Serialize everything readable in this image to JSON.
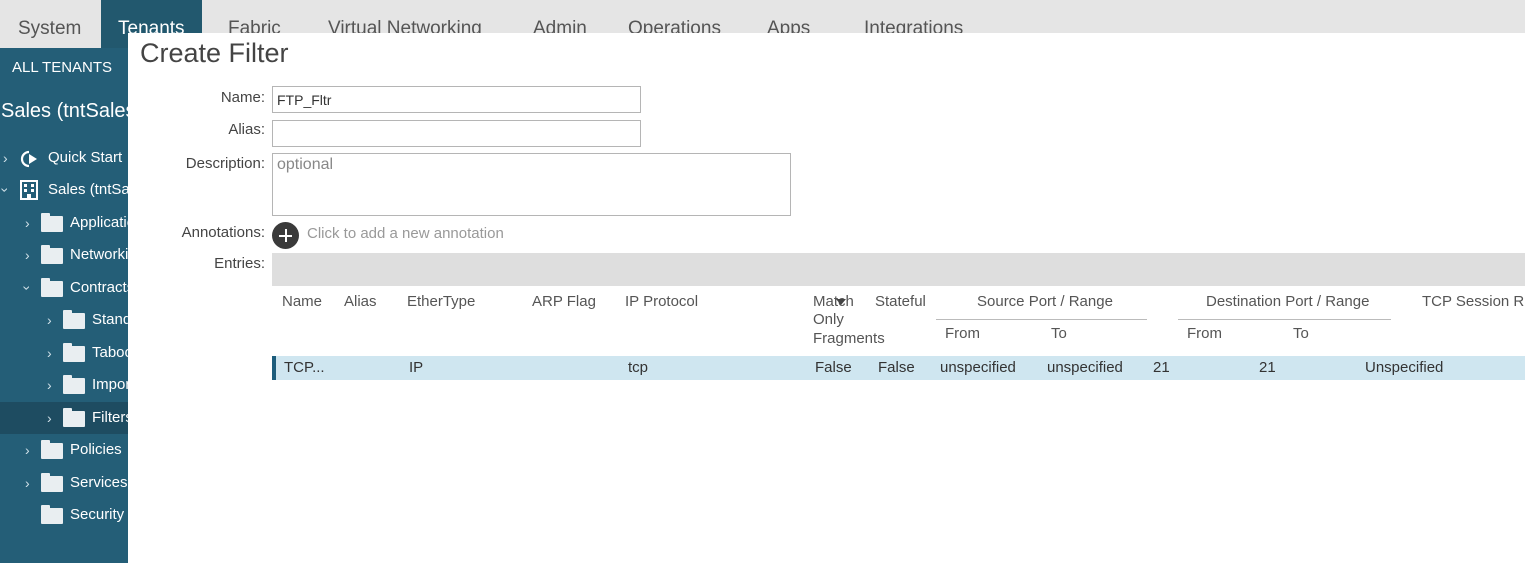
{
  "topnav": {
    "tabs": [
      {
        "label": "System",
        "active": false
      },
      {
        "label": "Tenants",
        "active": true
      },
      {
        "label": "Fabric",
        "active": false
      },
      {
        "label": "Virtual Networking",
        "active": false
      },
      {
        "label": "Admin",
        "active": false
      },
      {
        "label": "Operations",
        "active": false
      },
      {
        "label": "Apps",
        "active": false
      },
      {
        "label": "Integrations",
        "active": false
      }
    ]
  },
  "sidebar": {
    "all_tenants": "ALL TENANTS",
    "tenant_title": "Sales (tntSales)",
    "items": [
      {
        "label": "Quick Start",
        "icon": "quick-start-icon"
      },
      {
        "label": "Sales (tntSales)",
        "icon": "building-icon"
      },
      {
        "label": "Application Profiles",
        "icon": "folder-icon"
      },
      {
        "label": "Networking",
        "icon": "folder-icon"
      },
      {
        "label": "Contracts",
        "icon": "folder-icon"
      },
      {
        "label": "Standard",
        "icon": "folder-icon"
      },
      {
        "label": "Taboos",
        "icon": "folder-icon"
      },
      {
        "label": "Imported",
        "icon": "folder-icon"
      },
      {
        "label": "Filters",
        "icon": "folder-icon"
      },
      {
        "label": "Policies",
        "icon": "folder-icon"
      },
      {
        "label": "Services",
        "icon": "folder-icon"
      },
      {
        "label": "Security",
        "icon": "folder-icon"
      }
    ]
  },
  "dialog": {
    "title": "Create Filter",
    "name_label": "Name:",
    "name_value": "FTP_Fltr",
    "alias_label": "Alias:",
    "alias_value": "",
    "description_label": "Description:",
    "description_placeholder": "optional",
    "annotations_label": "Annotations:",
    "annotation_hint": "Click to add a new annotation",
    "entries_label": "Entries:"
  },
  "entries_table": {
    "columns": {
      "name": "Name",
      "alias": "Alias",
      "ethertype": "EtherType",
      "arp_flag": "ARP Flag",
      "ip_protocol": "IP Protocol",
      "match_only_1": "Match",
      "match_only_2": "Only",
      "match_only_3": "Fragments",
      "stateful": "Stateful",
      "source_port": "Source Port / Range",
      "destination_port": "Destination Port / Range",
      "tcp_session": "TCP Session Rules",
      "from": "From",
      "to": "To"
    },
    "rows": [
      {
        "name": "TCP...",
        "alias": "",
        "ethertype": "IP",
        "arp_flag": "",
        "ip_protocol": "tcp",
        "match_only_fragments": "False",
        "stateful": "False",
        "source_from": "unspecified",
        "source_to": "unspecified",
        "dest_from": "21",
        "dest_to": "21",
        "tcp_session": "Unspecified"
      }
    ]
  },
  "colors": {
    "sidebar": "#245e77",
    "active_tab": "#22586e",
    "selected_row": "#cfe6f0"
  }
}
